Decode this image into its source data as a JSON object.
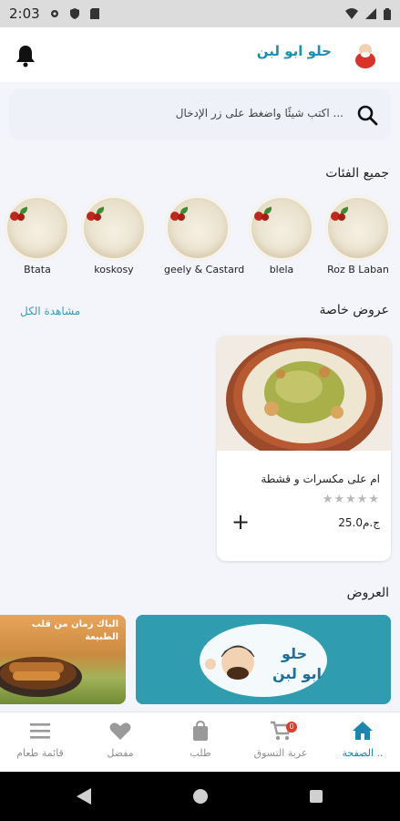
{
  "status_bar": {
    "time": "2:03"
  },
  "header": {
    "brand_name": "حلو ابو لبن"
  },
  "search": {
    "placeholder": "اكتب شيئًا واضغط على زر الإدخال ..."
  },
  "categories": {
    "title": "جميع الفئات",
    "items": [
      {
        "label": "Roz B Laban"
      },
      {
        "label": "blela"
      },
      {
        "label": "geely & Castard"
      },
      {
        "label": "koskosy"
      },
      {
        "label": "Btata"
      }
    ]
  },
  "special_offers": {
    "title": "عروض خاصة",
    "see_all": "مشاهدة الكل",
    "products": [
      {
        "name": "ام على مكسرات و قشطة",
        "stars": "★★★★★",
        "rating": 0,
        "price": "25.0ج.م",
        "add": "+"
      }
    ]
  },
  "offers": {
    "title": "العروض",
    "banner_left_text": "الباك زمان من قلب الطبيعة"
  },
  "bottom_nav": {
    "items": [
      {
        "label": "الصفحة ..",
        "icon": "home-icon",
        "active": true
      },
      {
        "label": "عربة التسوق",
        "icon": "cart-icon",
        "badge": "0"
      },
      {
        "label": "طلب",
        "icon": "bag-icon"
      },
      {
        "label": "مفضل",
        "icon": "heart-icon"
      },
      {
        "label": "قائمة طعام",
        "icon": "menu-icon"
      }
    ]
  },
  "colors": {
    "accent": "#1d86b0",
    "brand": "#1b8fb3",
    "banner": "#2f9cb0",
    "badge": "#e23b2e"
  }
}
